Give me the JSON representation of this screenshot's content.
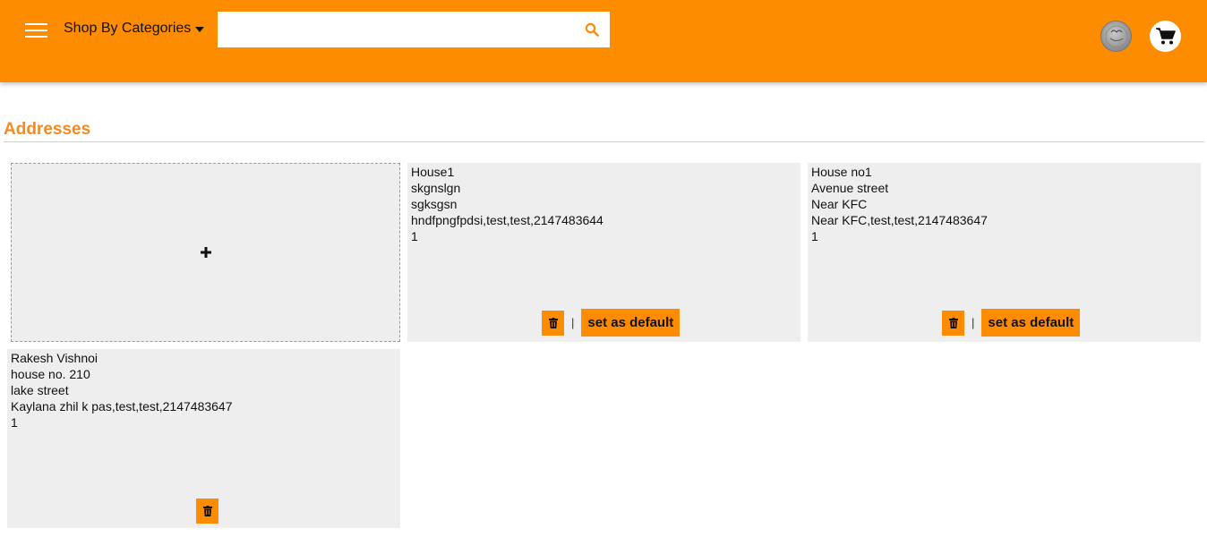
{
  "header": {
    "categories_label": "Shop By Categories",
    "search": {
      "value": "",
      "placeholder": ""
    },
    "icons": [
      "menu-icon",
      "chevron-down-icon",
      "search-icon",
      "avatar",
      "cart-icon"
    ],
    "brand_color": "#fd8c00"
  },
  "page": {
    "title": "Addresses",
    "title_color": "#f6891f"
  },
  "add_card": {
    "icon": "plus-icon",
    "symbol": "+"
  },
  "addresses": [
    {
      "lines": [
        "House1",
        "skgnslgn",
        "sgksgsn",
        "hndfpngfpdsi,test,test,2147483644",
        "1"
      ],
      "separator": "|",
      "default_label": "set as default"
    },
    {
      "lines": [
        "House no1",
        "Avenue street",
        "Near KFC",
        "Near KFC,test,test,2147483647",
        "1"
      ],
      "separator": "|",
      "default_label": "set as default"
    },
    {
      "lines": [
        "Rakesh Vishnoi",
        "house no. 210",
        "lake street",
        "Kaylana zhil k pas,test,test,2147483647",
        "1"
      ]
    }
  ]
}
